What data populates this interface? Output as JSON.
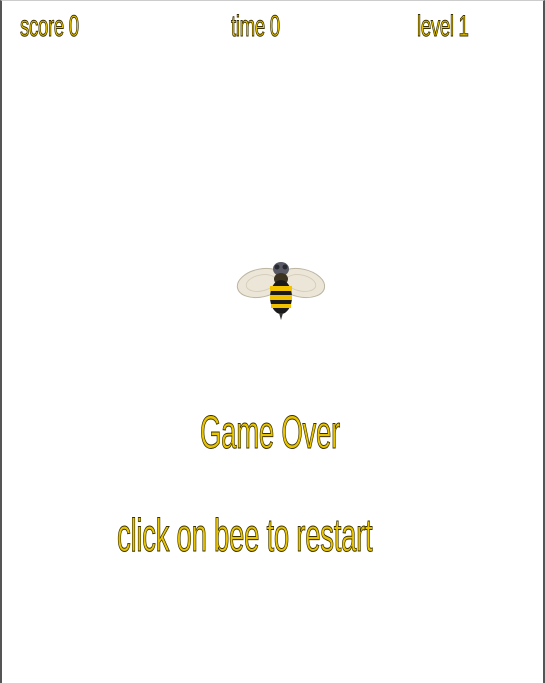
{
  "hud": {
    "score": "score 0",
    "time": "time 0",
    "level": "level 1"
  },
  "messages": {
    "game_over": "Game Over",
    "restart": "click on bee to restart"
  },
  "colors": {
    "text": "#e8c400",
    "text_outline": "#3a3000",
    "background": "#ffffff"
  },
  "icons": {
    "bee": "bee-icon"
  }
}
